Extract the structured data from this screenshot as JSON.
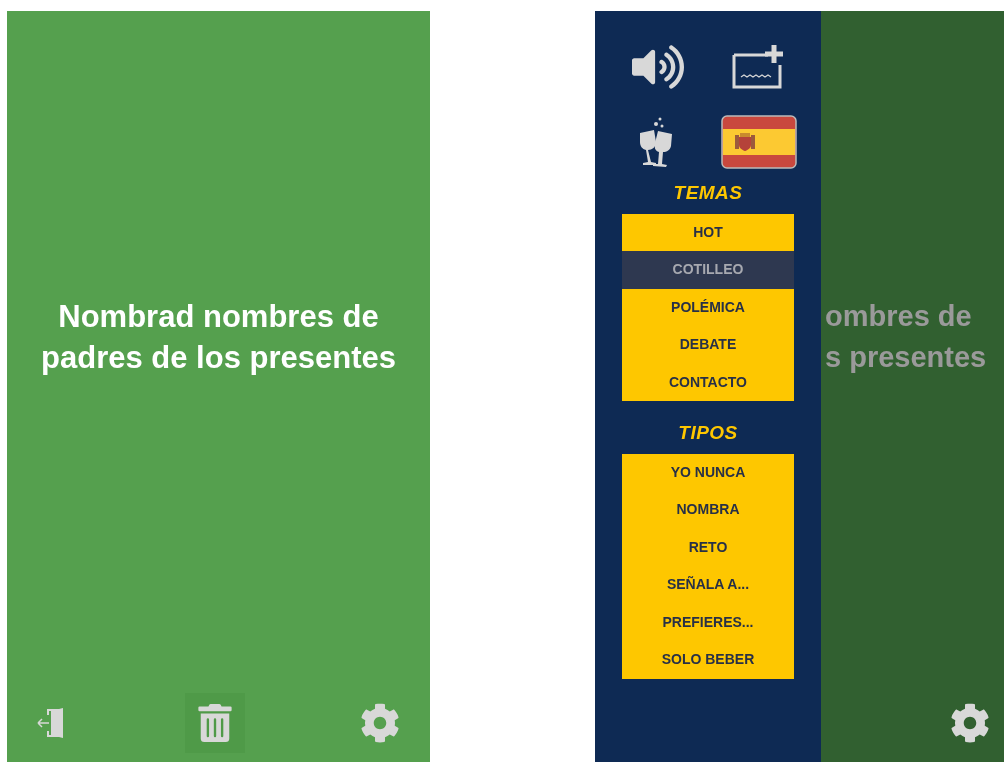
{
  "left_screen": {
    "prompt_lines": [
      "Nombrad nombres de",
      "padres de los presentes"
    ]
  },
  "right_screen": {
    "prompt_lines": [
      "ombres de",
      "s presentes"
    ],
    "menu": {
      "themes_title": "TEMAS",
      "themes": [
        {
          "label": "HOT",
          "on": true
        },
        {
          "label": "COTILLEO",
          "on": false
        },
        {
          "label": "POLÉMICA",
          "on": true
        },
        {
          "label": "DEBATE",
          "on": true
        },
        {
          "label": "CONTACTO",
          "on": true
        }
      ],
      "types_title": "TIPOS",
      "types": [
        {
          "label": "YO NUNCA",
          "on": true
        },
        {
          "label": "NOMBRA",
          "on": true
        },
        {
          "label": "RETO",
          "on": true
        },
        {
          "label": "SEÑALA A...",
          "on": true
        },
        {
          "label": "PREFIERES...",
          "on": true
        },
        {
          "label": "SOLO BEBER",
          "on": true
        }
      ]
    }
  }
}
